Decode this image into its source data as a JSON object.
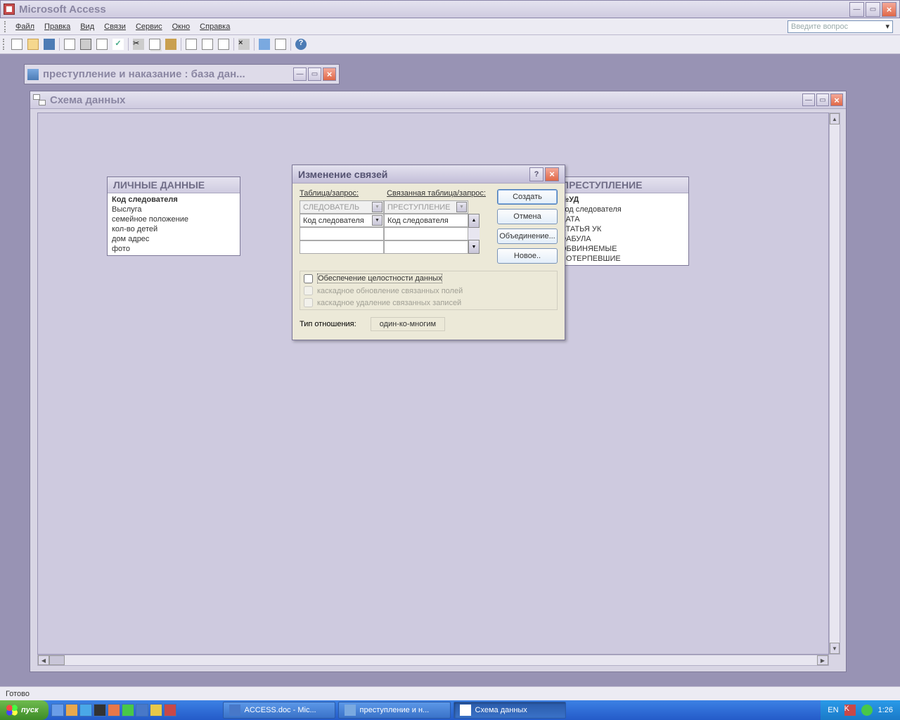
{
  "app": {
    "title": "Microsoft Access"
  },
  "menu": {
    "items": [
      "Файл",
      "Правка",
      "Вид",
      "Связи",
      "Сервис",
      "Окно",
      "Справка"
    ],
    "question": "Введите вопрос"
  },
  "dbwin": {
    "title": "преступление и наказание : база дан..."
  },
  "schema": {
    "title": "Схема данных"
  },
  "tables": {
    "left": {
      "title": "ЛИЧНЫЕ ДАННЫЕ",
      "pk": "Код следователя",
      "fields": [
        "Выслуга",
        "семейное положение",
        "кол-во детей",
        "дом адрес",
        "фото"
      ]
    },
    "right": {
      "title": "ПРЕСТУПЛЕНИЕ",
      "pk": "№УД",
      "fields": [
        "Код следователя",
        "ДАТА",
        "СТАТЬЯ УК",
        "ФАБУЛА",
        "ОБВИНЯЕМЫЕ",
        "ПОТЕРПЕВШИЕ"
      ]
    }
  },
  "dialog": {
    "title": "Изменение связей",
    "labels": {
      "table": "Таблица/запрос:",
      "related": "Связанная таблица/запрос:"
    },
    "combo_left": "СЛЕДОВАТЕЛЬ",
    "combo_right": "ПРЕСТУПЛЕНИЕ",
    "field_left": "Код следователя",
    "field_right": "Код следователя",
    "buttons": {
      "create": "Создать",
      "cancel": "Отмена",
      "join": "Объединение...",
      "new": "Новое.."
    },
    "checks": {
      "integrity": "Обеспечение целостности данных",
      "cascade_upd": "каскадное обновление связанных полей",
      "cascade_del": "каскадное удаление связанных записей"
    },
    "rel_label": "Тип отношения:",
    "rel_value": "один-ко-многим"
  },
  "status": "Готово",
  "taskbar": {
    "start": "пуск",
    "tasks": [
      {
        "label": "ACCESS.doc - Mic...",
        "active": false
      },
      {
        "label": "преступление и н...",
        "active": false
      },
      {
        "label": "Схема данных",
        "active": true
      }
    ],
    "lang": "EN",
    "time": "1:26"
  }
}
